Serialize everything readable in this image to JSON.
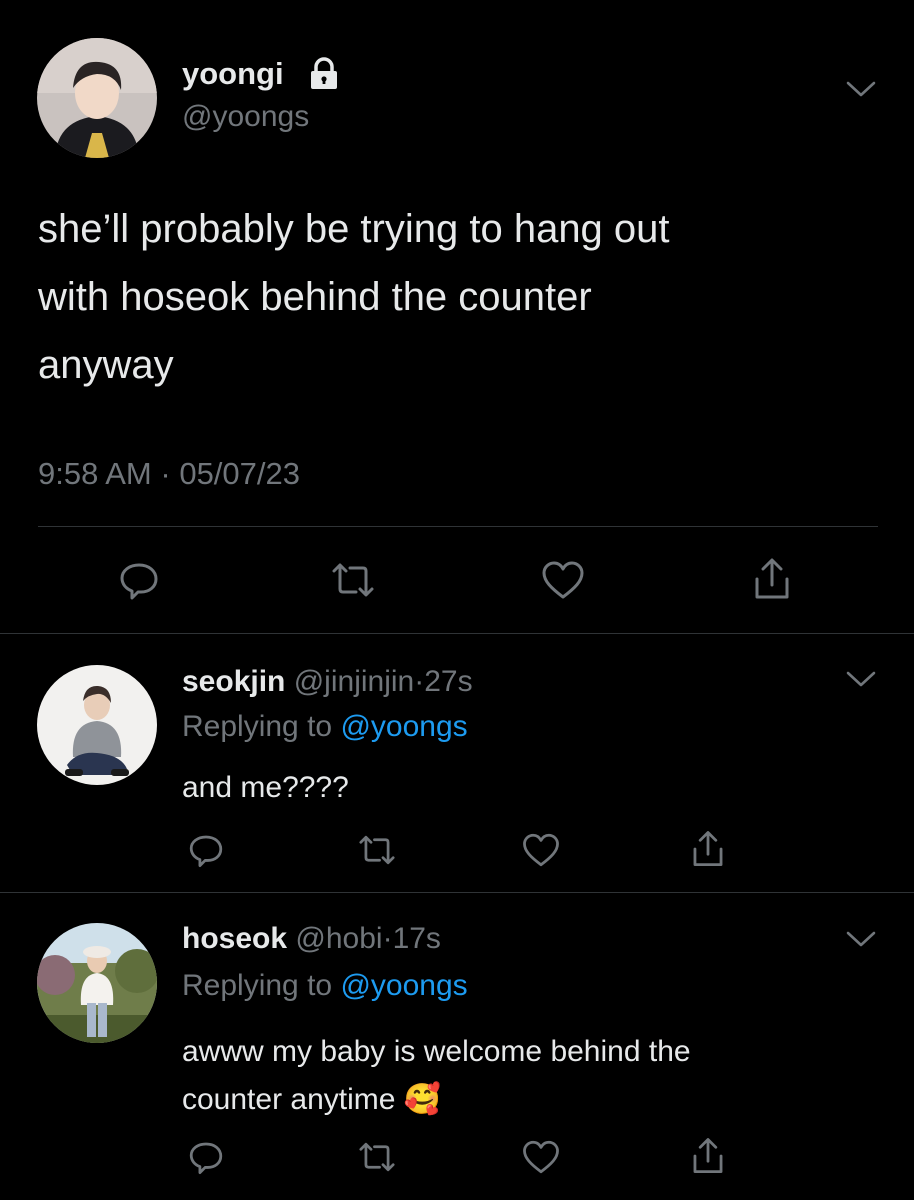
{
  "main_tweet": {
    "display_name": "yoongi",
    "handle": "@yoongs",
    "text_lines": [
      "she’ll probably be trying to hang out",
      "with hoseok behind the counter",
      "anyway"
    ],
    "time": "9:58 AM",
    "date": "05/07/23",
    "separator": "·"
  },
  "replies": [
    {
      "display_name": "seokjin",
      "handle": "@jinjinjin",
      "separator": "·",
      "age": "27s",
      "replying_prefix": "Replying to",
      "replying_handle": "@yoongs",
      "text_lines": [
        "and me????"
      ]
    },
    {
      "display_name": "hoseok",
      "handle": "@hobi",
      "separator": "·",
      "age": "17s",
      "replying_prefix": "Replying to",
      "replying_handle": "@yoongs",
      "text_lines": [
        "awww my baby is welcome behind the",
        "counter anytime"
      ],
      "emoji": "🥰"
    }
  ],
  "icons": {
    "lock": "lock-icon",
    "chevron": "chevron-down-icon",
    "reply": "reply-icon",
    "retweet": "retweet-icon",
    "like": "heart-icon",
    "share": "share-icon"
  },
  "colors": {
    "background": "#000000",
    "text": "#e7e9ea",
    "muted": "#71767b",
    "link": "#1d9bf0",
    "divider": "#2f3336"
  }
}
